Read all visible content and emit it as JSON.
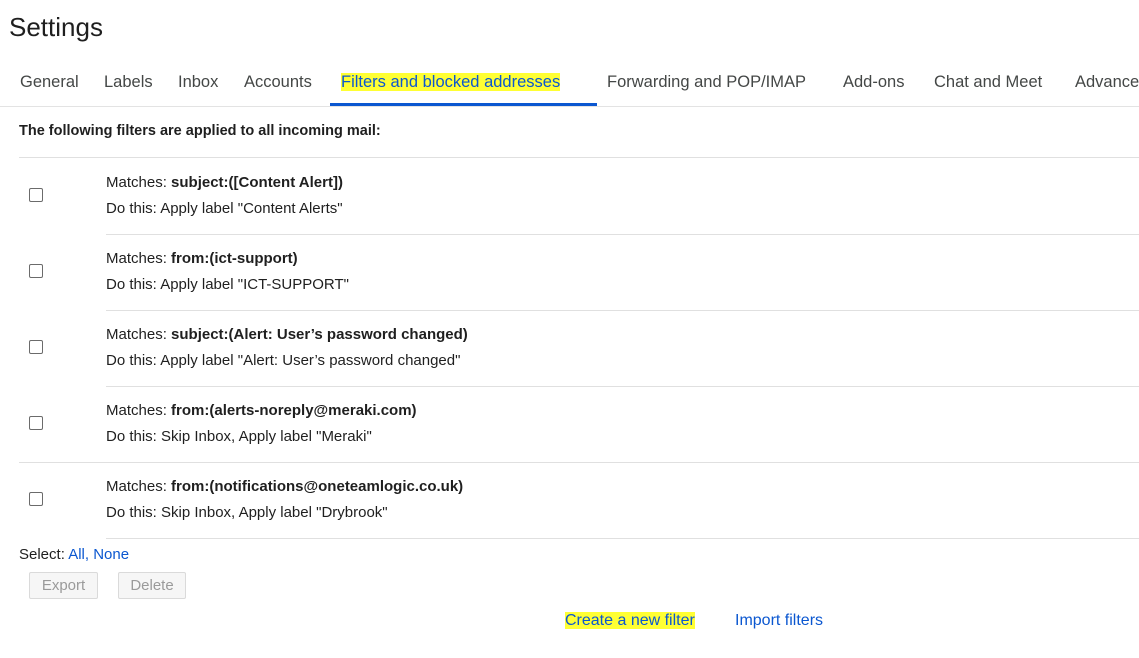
{
  "header": {
    "title": "Settings"
  },
  "tabs": [
    {
      "label": "General"
    },
    {
      "label": "Labels"
    },
    {
      "label": "Inbox"
    },
    {
      "label": "Accounts"
    },
    {
      "label": "Filters and blocked addresses"
    },
    {
      "label": "Forwarding and POP/IMAP"
    },
    {
      "label": "Add-ons"
    },
    {
      "label": "Chat and Meet"
    },
    {
      "label": "Advanced"
    }
  ],
  "active_tab": "Filters and blocked addresses",
  "section": {
    "heading": "The following filters are applied to all incoming mail:"
  },
  "filters": [
    {
      "matches_prefix": "Matches: ",
      "criteria": "subject:([Content Alert])",
      "action": "Do this: Apply label \"Content Alerts\""
    },
    {
      "matches_prefix": "Matches: ",
      "criteria": "from:(ict-support)",
      "action": "Do this: Apply label \"ICT-SUPPORT\""
    },
    {
      "matches_prefix": "Matches: ",
      "criteria": "subject:(Alert: User’s password changed)",
      "action": "Do this: Apply label \"Alert: User’s password changed\""
    },
    {
      "matches_prefix": "Matches: ",
      "criteria": "from:(alerts-noreply@meraki.com)",
      "action": "Do this: Skip Inbox, Apply label \"Meraki\""
    },
    {
      "matches_prefix": "Matches: ",
      "criteria": "from:(notifications@oneteamlogic.co.uk)",
      "action": "Do this: Skip Inbox, Apply label \"Drybrook\""
    }
  ],
  "select": {
    "label": "Select: ",
    "all": "All",
    "separator": ", ",
    "none": "None"
  },
  "buttons": {
    "export": "Export",
    "delete": "Delete"
  },
  "footer_links": {
    "create": "Create a new filter",
    "import": "Import filters"
  },
  "colors": {
    "accent": "#0b57d0",
    "highlight": "#ffff33",
    "text": "#1f1f1f",
    "tab_text": "#444746",
    "divider": "#e0e0e0"
  },
  "icons": {
    "checkbox": "checkbox-unchecked"
  }
}
